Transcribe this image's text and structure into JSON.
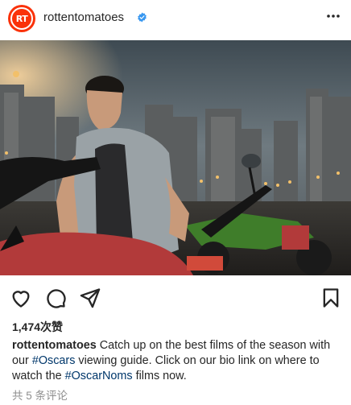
{
  "account": {
    "avatar_text": "RT",
    "username": "rottentomatoes",
    "verified": true,
    "brand_color": "#fa320a",
    "verified_color": "#3897f0"
  },
  "header": {
    "more_icon": "more-horizontal-icon"
  },
  "post": {
    "image_description_icon": "photo",
    "actions": {
      "like_icon": "heart-icon",
      "comment_icon": "comment-icon",
      "share_icon": "send-icon",
      "save_icon": "bookmark-icon"
    },
    "likes_text": "1,474次赞",
    "caption": {
      "username": "rottentomatoes",
      "part1": " Catch up on the best films of the season with our ",
      "tag1": "#Oscars",
      "part2": " viewing guide. Click on our bio link on where to watch the ",
      "tag2": "#OscarNoms",
      "part3": " films now."
    },
    "comments_text": "共 5 条评论",
    "link_color": "#00376b"
  }
}
